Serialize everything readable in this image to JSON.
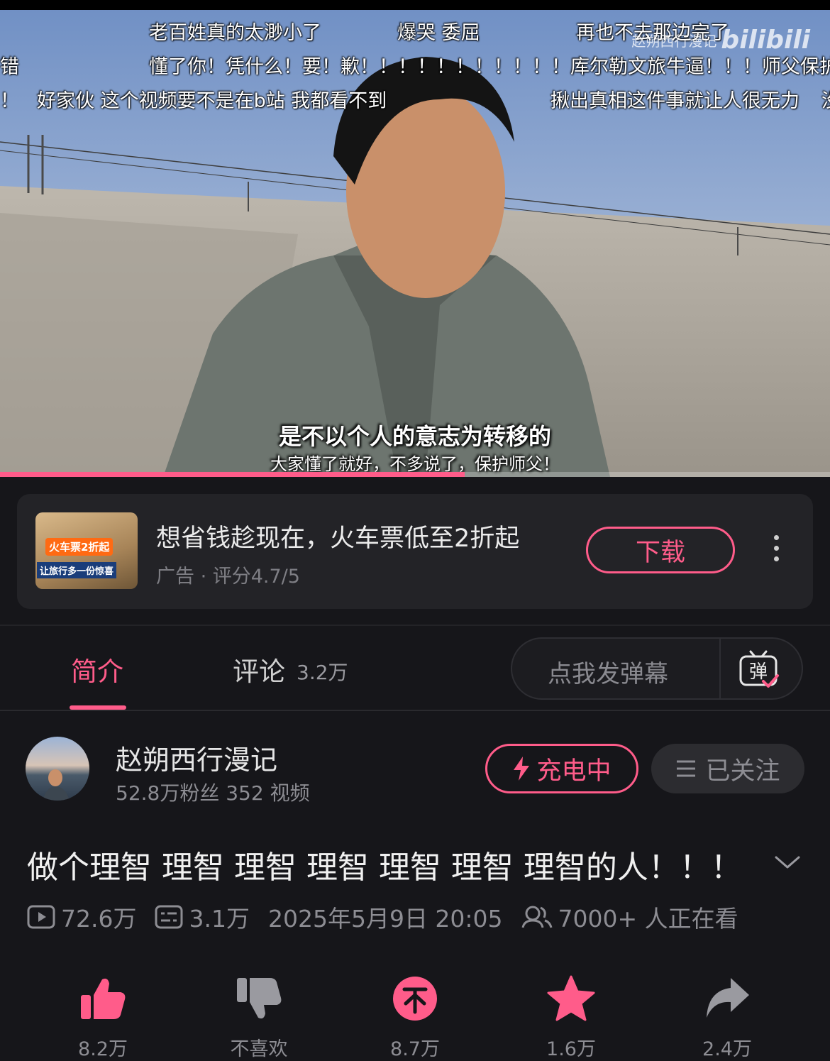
{
  "player": {
    "danmaku": [
      {
        "text": "老百姓真的太渺小了"
      },
      {
        "text": "爆哭 委屈"
      },
      {
        "text": "再也不去那边完了"
      },
      {
        "text": "错"
      },
      {
        "text": "懂了你！凭什么！要！歉！！！！！！！！！！！库尔勒文旅牛逼！！！师父保护好自己"
      },
      {
        "text": "！"
      },
      {
        "text": "好家伙 这个视频要不是在b站 我都看不到"
      },
      {
        "text": "揪出真相这件事就让人很无力"
      },
      {
        "text": "没"
      }
    ],
    "watermark_channel": "赵朔西行漫记",
    "watermark_logo": "bilibili",
    "subtitle_line1": "是不以个人的意志为转移的",
    "subtitle_line2": "大家懂了就好，不多说了，保护师父！",
    "progress": 0.56
  },
  "ad": {
    "thumb_tag1": "火车票2折起",
    "thumb_tag2": "让旅行多一份惊喜",
    "title": "想省钱趁现在，火车票低至2折起",
    "meta": "广告 · 评分4.7/5",
    "button_label": "下载"
  },
  "tabs": {
    "intro_label": "简介",
    "comment_label": "评论",
    "comment_count": "3.2万",
    "danmu_placeholder": "点我发弹幕",
    "danmu_icon_char": "弹"
  },
  "uploader": {
    "name": "赵朔西行漫记",
    "stats": "52.8万粉丝   352 视频",
    "charge_label": "充电中",
    "follow_label": "已关注"
  },
  "video": {
    "title": "做个理智 理智 理智 理智 理智 理智 理智的人！！！",
    "views": "72.6万",
    "danmaku_count": "3.1万",
    "publish_time": "2025年5月9日 20:05",
    "watching": "7000+ 人正在看"
  },
  "actions": {
    "like": "8.2万",
    "dislike": "不喜欢",
    "coin": "8.7万",
    "favorite": "1.6万",
    "share": "2.4万"
  },
  "colors": {
    "accent": "#ff5c8a",
    "background": "#16161a",
    "card": "#232327"
  }
}
